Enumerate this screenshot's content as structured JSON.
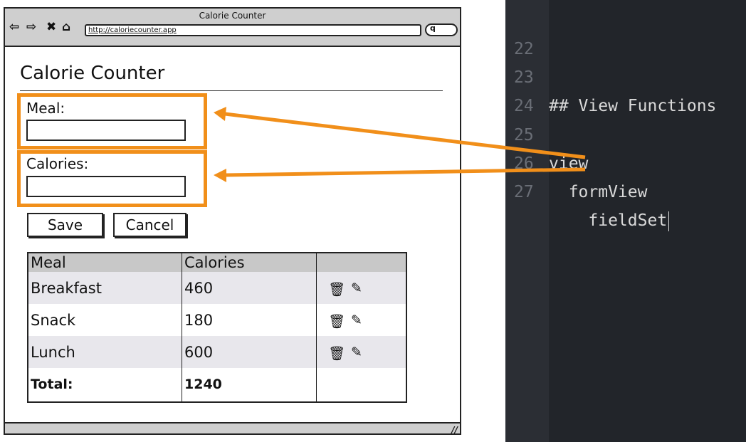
{
  "browser": {
    "window_title": "Calorie Counter",
    "url": "http://caloriecounter.app",
    "search_glyph": "q",
    "nav_icons": [
      "back-arrow-icon",
      "forward-arrow-icon",
      "stop-icon",
      "home-icon"
    ]
  },
  "app": {
    "title": "Calorie Counter",
    "fields": {
      "meal_label": "Meal:",
      "meal_value": "",
      "calories_label": "Calories:",
      "calories_value": ""
    },
    "buttons": {
      "save": "Save",
      "cancel": "Cancel"
    },
    "table": {
      "headers": [
        "Meal",
        "Calories",
        ""
      ],
      "rows": [
        {
          "meal": "Breakfast",
          "calories": "460"
        },
        {
          "meal": "Snack",
          "calories": "180"
        },
        {
          "meal": "Lunch",
          "calories": "600"
        }
      ],
      "total_label": "Total:",
      "total_value": "1240",
      "row_actions": [
        "trash-icon",
        "edit-icon"
      ]
    }
  },
  "editor": {
    "lines": [
      {
        "num": "22",
        "text": ""
      },
      {
        "num": "23",
        "text": "## View Functions"
      },
      {
        "num": "24",
        "text": ""
      },
      {
        "num": "25",
        "text": "view"
      },
      {
        "num": "26",
        "text": "  formView"
      },
      {
        "num": "27",
        "text": "    fieldSet"
      }
    ]
  },
  "colors": {
    "highlight": "#f18f1a",
    "editor_bg": "#22252a",
    "gutter_bg": "#2b2e34",
    "code_text": "#d9d9d9",
    "line_numbers": "#6a6e76",
    "header_gray": "#c8c8c8",
    "row_stripe": "#e8e7ec"
  }
}
